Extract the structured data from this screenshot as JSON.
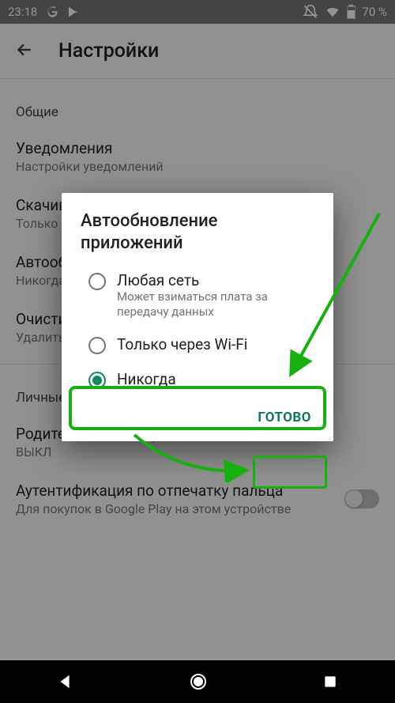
{
  "status": {
    "time": "23:18",
    "battery": "70 %"
  },
  "appbar": {
    "title": "Настройки"
  },
  "sections": {
    "general_label": "Общие",
    "notifications": {
      "title": "Уведомления",
      "sub": "Настройки уведомлений"
    },
    "download": {
      "title": "Скачивание приложений",
      "sub": "Только по Wi-Fi"
    },
    "autoupdate": {
      "title": "Автообновление приложений",
      "sub": "Никогда"
    },
    "clear": {
      "title": "Очистить историю поиска",
      "sub": "Удалить все поисковые запросы с устройства"
    },
    "personal_label": "Личные",
    "parental": {
      "title": "Родительский контроль",
      "sub": "ВЫКЛ"
    },
    "fingerprint": {
      "title": "Аутентификация по отпечатку пальца",
      "sub": "Для покупок в Google Play на этом устройстве"
    }
  },
  "dialog": {
    "title": "Автообновление приложений",
    "options": [
      {
        "label": "Любая сеть",
        "sub": "Может взиматься плата за передачу данных"
      },
      {
        "label": "Только через Wi-Fi",
        "sub": ""
      },
      {
        "label": "Никогда",
        "sub": ""
      }
    ],
    "selected_index": 2,
    "done": "ГОТОВО"
  }
}
